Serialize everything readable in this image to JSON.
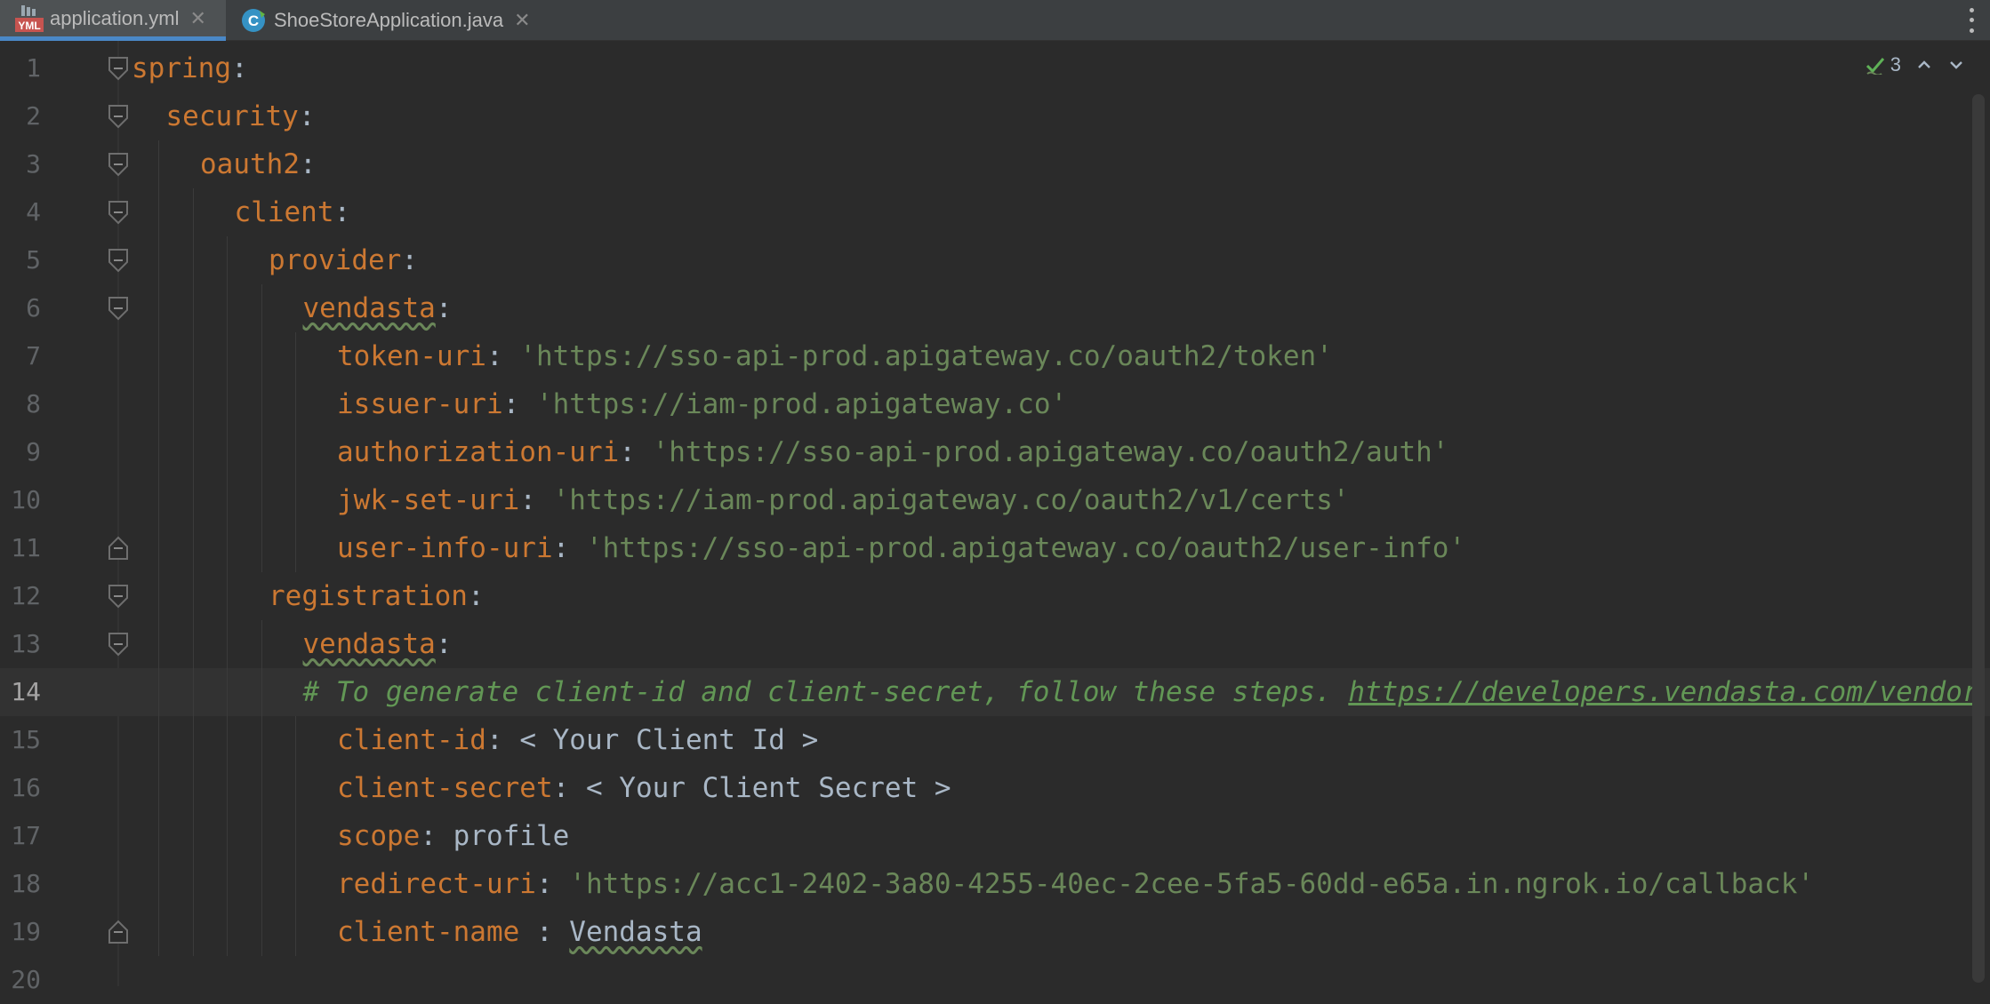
{
  "tabs": [
    {
      "label": "application.yml",
      "icon": "yml-file-icon",
      "icon_text": "YML",
      "active": true
    },
    {
      "label": "ShoeStoreApplication.java",
      "icon": "java-class-icon",
      "icon_text": "C",
      "active": false
    }
  ],
  "inspections": {
    "count": "3"
  },
  "colors": {
    "background": "#2b2b2b",
    "key": "#cc7832",
    "string": "#6a8759",
    "comment": "#629755",
    "plain": "#a9b7c6",
    "line_number": "#606366",
    "tab_accent": "#4a88c7"
  },
  "lines": [
    {
      "num": "1",
      "indent": 0,
      "key": "spring",
      "sep": ":"
    },
    {
      "num": "2",
      "indent": 1,
      "key": "security",
      "sep": ":"
    },
    {
      "num": "3",
      "indent": 2,
      "key": "oauth2",
      "sep": ":"
    },
    {
      "num": "4",
      "indent": 3,
      "key": "client",
      "sep": ":"
    },
    {
      "num": "5",
      "indent": 4,
      "key": "provider",
      "sep": ":"
    },
    {
      "num": "6",
      "indent": 5,
      "key": "vendasta",
      "sep": ":"
    },
    {
      "num": "7",
      "indent": 6,
      "key": "token-uri",
      "sep": ": ",
      "value": "'https://sso-api-prod.apigateway.co/oauth2/token'"
    },
    {
      "num": "8",
      "indent": 6,
      "key": "issuer-uri",
      "sep": ": ",
      "value": "'https://iam-prod.apigateway.co'"
    },
    {
      "num": "9",
      "indent": 6,
      "key": "authorization-uri",
      "sep": ": ",
      "value": "'https://sso-api-prod.apigateway.co/oauth2/auth'"
    },
    {
      "num": "10",
      "indent": 6,
      "key": "jwk-set-uri",
      "sep": ": ",
      "value": "'https://iam-prod.apigateway.co/oauth2/v1/certs'"
    },
    {
      "num": "11",
      "indent": 6,
      "key": "user-info-uri",
      "sep": ": ",
      "value": "'https://sso-api-prod.apigateway.co/oauth2/user-info'"
    },
    {
      "num": "12",
      "indent": 4,
      "key": "registration",
      "sep": ":"
    },
    {
      "num": "13",
      "indent": 5,
      "key": "vendasta",
      "sep": ":"
    },
    {
      "num": "14",
      "indent": 5,
      "comment": "# To generate client-id and client-secret, follow these steps. ",
      "link": "https://developers.vendasta.com/vendor"
    },
    {
      "num": "15",
      "indent": 6,
      "key": "client-id",
      "sep": ": ",
      "plain": "< Your Client Id >"
    },
    {
      "num": "16",
      "indent": 6,
      "key": "client-secret",
      "sep": ": ",
      "plain": "< Your Client Secret >"
    },
    {
      "num": "17",
      "indent": 6,
      "key": "scope",
      "sep": ": ",
      "plain": "profile"
    },
    {
      "num": "18",
      "indent": 6,
      "key": "redirect-uri",
      "sep": ": ",
      "value": "'https://acc1-2402-3a80-4255-40ec-2cee-5fa5-60dd-e65a.in.ngrok.io/callback'"
    },
    {
      "num": "19",
      "indent": 6,
      "key": "client-name ",
      "sep": ": ",
      "plain": "Vendasta"
    },
    {
      "num": "20",
      "indent": 0
    }
  ]
}
